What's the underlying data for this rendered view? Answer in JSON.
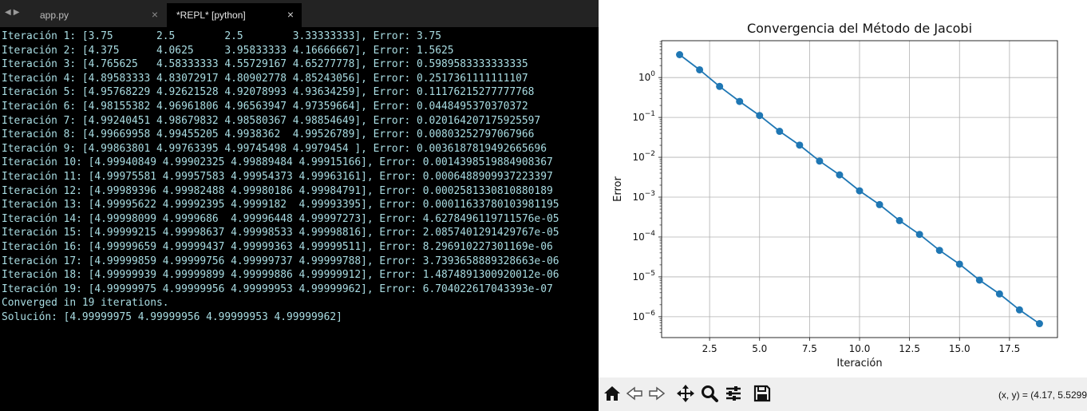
{
  "tabs": [
    {
      "label": "app.py",
      "close": "×",
      "active": false
    },
    {
      "label": "*REPL* [python]",
      "close": "×",
      "active": true
    }
  ],
  "console_lines": [
    "Iteración 1: [3.75       2.5        2.5        3.33333333], Error: 3.75",
    "Iteración 2: [4.375      4.0625     3.95833333 4.16666667], Error: 1.5625",
    "Iteración 3: [4.765625   4.58333333 4.55729167 4.65277778], Error: 0.5989583333333335",
    "Iteración 4: [4.89583333 4.83072917 4.80902778 4.85243056], Error: 0.2517361111111107",
    "Iteración 5: [4.95768229 4.92621528 4.92078993 4.93634259], Error: 0.11176215277777768",
    "Iteración 6: [4.98155382 4.96961806 4.96563947 4.97359664], Error: 0.0448495370370372",
    "Iteración 7: [4.99240451 4.98679832 4.98580367 4.98854649], Error: 0.020164207175925597",
    "Iteración 8: [4.99669958 4.99455205 4.9938362  4.99526789], Error: 0.00803252797067966",
    "Iteración 9: [4.99863801 4.99763395 4.99745498 4.9979454 ], Error: 0.0036187819492665696",
    "Iteración 10: [4.99940849 4.99902325 4.99889484 4.99915166], Error: 0.0014398519884908367",
    "Iteración 11: [4.99975581 4.99957583 4.99954373 4.99963161], Error: 0.0006488909937223397",
    "Iteración 12: [4.99989396 4.99982488 4.99980186 4.99984791], Error: 0.0002581330810880189",
    "Iteración 13: [4.99995622 4.99992395 4.9999182  4.99993395], Error: 0.00011633780103981195",
    "Iteración 14: [4.99998099 4.9999686  4.99996448 4.99997273], Error: 4.6278496119711576e-05",
    "Iteración 15: [4.99999215 4.99998637 4.99998533 4.99998816], Error: 2.0857401291429767e-05",
    "Iteración 16: [4.99999659 4.99999437 4.99999363 4.99999511], Error: 8.296910227301169e-06",
    "Iteración 17: [4.99999859 4.99999756 4.99999737 4.99999788], Error: 3.7393658889328663e-06",
    "Iteración 18: [4.99999939 4.99999899 4.99999886 4.99999912], Error: 1.4874891300920012e-06",
    "Iteración 19: [4.99999975 4.99999956 4.99999953 4.99999962], Error: 6.704022617043393e-07",
    "Converged in 19 iterations.",
    "Solución: [4.99999975 4.99999956 4.99999953 4.99999962]"
  ],
  "figure": {
    "coords_readout": "(x, y) = (4.17, 5.5299",
    "toolbar_icons": [
      "home-icon",
      "back-icon",
      "forward-icon",
      "pan-icon",
      "zoom-icon",
      "configure-subplots-icon",
      "save-icon"
    ]
  },
  "chart_data": {
    "type": "line",
    "title": "Convergencia del Método de Jacobi",
    "xlabel": "Iteración",
    "ylabel": "Error",
    "yscale": "log",
    "grid": true,
    "color": "#1f77b4",
    "xlim": [
      0.1,
      19.9
    ],
    "ylim": [
      3e-07,
      8.4
    ],
    "xticks": [
      {
        "v": 2.5,
        "label": "2.5"
      },
      {
        "v": 5.0,
        "label": "5.0"
      },
      {
        "v": 7.5,
        "label": "7.5"
      },
      {
        "v": 10.0,
        "label": "10.0"
      },
      {
        "v": 12.5,
        "label": "12.5"
      },
      {
        "v": 15.0,
        "label": "15.0"
      },
      {
        "v": 17.5,
        "label": "17.5"
      }
    ],
    "yticks": [
      {
        "v": 1,
        "base": "10",
        "exp": "0"
      },
      {
        "v": 0.1,
        "base": "10",
        "exp": "−1"
      },
      {
        "v": 0.01,
        "base": "10",
        "exp": "−2"
      },
      {
        "v": 0.001,
        "base": "10",
        "exp": "−3"
      },
      {
        "v": 0.0001,
        "base": "10",
        "exp": "−4"
      },
      {
        "v": 1e-05,
        "base": "10",
        "exp": "−5"
      },
      {
        "v": 1e-06,
        "base": "10",
        "exp": "−6"
      }
    ],
    "x": [
      1,
      2,
      3,
      4,
      5,
      6,
      7,
      8,
      9,
      10,
      11,
      12,
      13,
      14,
      15,
      16,
      17,
      18,
      19
    ],
    "y": [
      3.75,
      1.5625,
      0.5989583333333335,
      0.2517361111111107,
      0.11176215277777768,
      0.0448495370370372,
      0.020164207175925597,
      0.00803252797067966,
      0.0036187819492665696,
      0.0014398519884908367,
      0.0006488909937223397,
      0.0002581330810880189,
      0.00011633780103981195,
      4.6278496119711576e-05,
      2.0857401291429767e-05,
      8.296910227301169e-06,
      3.7393658889328663e-06,
      1.4874891300920012e-06,
      6.704022617043393e-07
    ]
  }
}
